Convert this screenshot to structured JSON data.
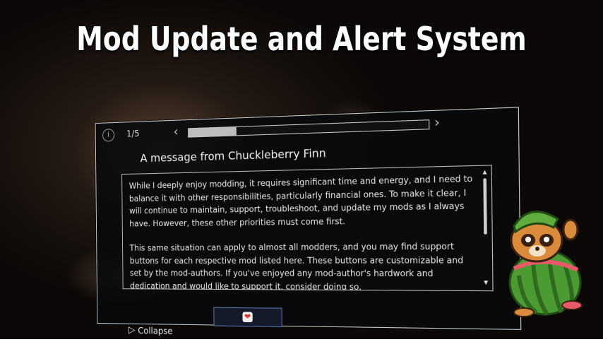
{
  "banner": {
    "title": "Mod Update and Alert System"
  },
  "panel": {
    "page_indicator": "1/5",
    "progress_fraction": 0.21,
    "title": "A message from Chuckleberry Finn",
    "paragraphs": [
      "While I deeply enjoy modding, it requires significant time and energy, and I need to balance it with other responsibilities, particularly financial ones. To make it clear, I will continue to maintain, support, troubleshoot, and update my mods as I always have. However, these other priorities must come first.",
      "This same situation can apply to almost all modders, and you may find support buttons for each respective mod listed here. These buttons are customizable and set by the mod-authors. If you've enjoyed any mod-author's hardwork and dedication and would like to support it, consider doing so."
    ],
    "collapse_label": "Collapse",
    "icons": {
      "info": "info-icon",
      "prev": "chevron-left-icon",
      "next": "chevron-right-icon",
      "support": "heart-icon",
      "collapse": "triangle-right-icon"
    }
  },
  "colors": {
    "panel_border": "#cfcfcf",
    "support_border": "#5a78b0",
    "heart": "#dd3333",
    "mascot_green": "#5fae3d",
    "mascot_orange": "#d98a3a"
  }
}
